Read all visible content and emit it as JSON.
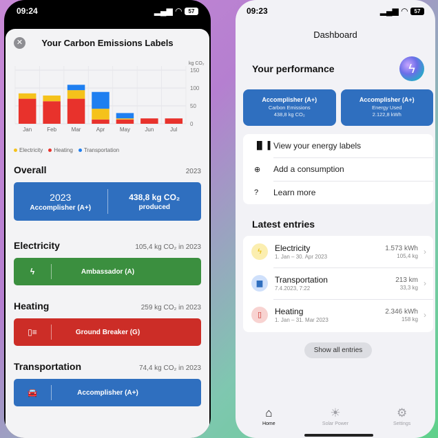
{
  "left_phone": {
    "status": {
      "time": "09:24",
      "battery": "57"
    },
    "sheet_title": "Your Carbon Emissions Labels",
    "chart_data": {
      "type": "bar",
      "stacked": true,
      "categories": [
        "Jan",
        "Feb",
        "Mar",
        "Apr",
        "May",
        "Jun",
        "Jul"
      ],
      "series": [
        {
          "name": "Electricity",
          "color": "#f5c21b",
          "values": [
            15,
            16,
            24,
            30,
            3,
            0,
            0
          ]
        },
        {
          "name": "Heating",
          "color": "#e8322c",
          "values": [
            70,
            63,
            70,
            12,
            12,
            15,
            15
          ]
        },
        {
          "name": "Transportation",
          "color": "#1f7ff0",
          "values": [
            0,
            0,
            15,
            47,
            15,
            0,
            0
          ]
        }
      ],
      "y_unit": "kg CO₂",
      "yticks": [
        0,
        50,
        100,
        150
      ],
      "ylim": [
        0,
        150
      ],
      "grid": true,
      "legend_position": "bottom-left"
    },
    "overall": {
      "title": "Overall",
      "year": "2023",
      "card_year": "2023",
      "card_label": "Accomplisher (A+)",
      "card_value": "438,8 kg CO₂",
      "card_value_suffix": "produced"
    },
    "electricity": {
      "title": "Electricity",
      "meta": "105,4 kg CO₂ in 2023",
      "label": "Ambassador (A)",
      "color": "#3b8f3f"
    },
    "heating": {
      "title": "Heating",
      "meta": "259 kg CO₂ in 2023",
      "label": "Ground Breaker (G)",
      "color": "#cc2d27"
    },
    "transportation": {
      "title": "Transportation",
      "meta": "74,4 kg CO₂ in 2023",
      "label": "Accomplisher (A+)",
      "color": "#2f6fbf"
    }
  },
  "right_phone": {
    "status": {
      "time": "09:23",
      "battery": "57"
    },
    "title": "Dashboard",
    "performance_title": "Your performance",
    "labels": [
      {
        "label": "Accomplisher (A+)",
        "category": "Carbon Emissions",
        "value": "438,8 kg CO₂"
      },
      {
        "label": "Accomplisher (A+)",
        "category": "Energy Used",
        "value": "2.122,8 kWh"
      }
    ],
    "menu": [
      {
        "icon": "bar-chart-icon",
        "label": "View your energy labels"
      },
      {
        "icon": "plus-circle-icon",
        "label": "Add a consumption"
      },
      {
        "icon": "question-circle-icon",
        "label": "Learn more"
      }
    ],
    "latest_title": "Latest entries",
    "entries": [
      {
        "icon": "lightning-icon",
        "name": "Electricity",
        "date": "1. Jan – 30. Apr 2023",
        "value1": "1.573 kWh",
        "value2": "105,4 kg"
      },
      {
        "icon": "car-icon",
        "name": "Transportation",
        "date": "7.4.2023, 7:22",
        "value1": "213 km",
        "value2": "33,3 kg"
      },
      {
        "icon": "heater-icon",
        "name": "Heating",
        "date": "1. Jan – 31. Mar 2023",
        "value1": "2.346 kWh",
        "value2": "158 kg"
      }
    ],
    "show_all": "Show all entries",
    "tabs": [
      {
        "icon": "home-icon",
        "label": "Home",
        "active": true
      },
      {
        "icon": "sun-icon",
        "label": "Solar Power",
        "active": false
      },
      {
        "icon": "settings-icon",
        "label": "Settings",
        "active": false
      }
    ]
  }
}
